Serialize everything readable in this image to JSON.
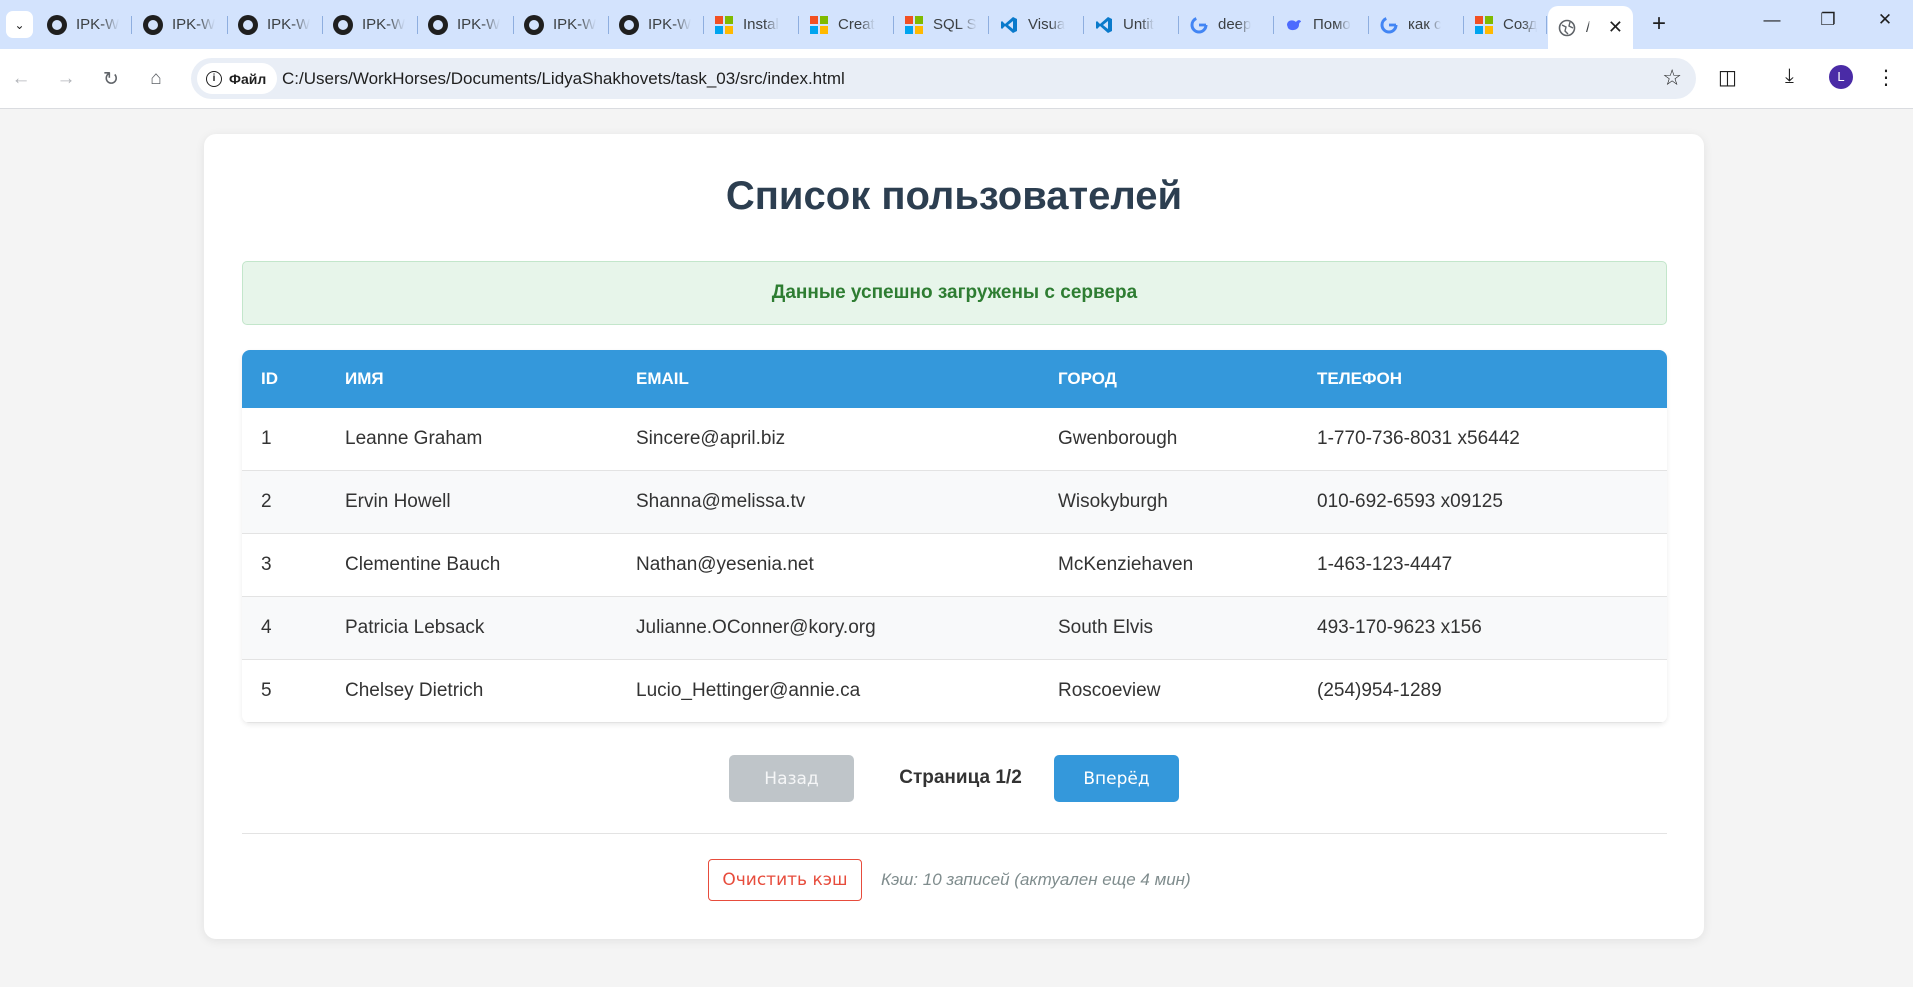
{
  "browser": {
    "tabs": [
      {
        "label": "IPK-W",
        "icon": "github-icon"
      },
      {
        "label": "IPK-W",
        "icon": "github-icon"
      },
      {
        "label": "IPK-W",
        "icon": "github-icon"
      },
      {
        "label": "IPK-W",
        "icon": "github-icon"
      },
      {
        "label": "IPK-W",
        "icon": "github-icon"
      },
      {
        "label": "IPK-W",
        "icon": "github-icon"
      },
      {
        "label": "IPK-W",
        "icon": "github-icon"
      },
      {
        "label": "Instal",
        "icon": "microsoft-icon"
      },
      {
        "label": "Creat",
        "icon": "microsoft-icon"
      },
      {
        "label": "SQL S",
        "icon": "microsoft-icon"
      },
      {
        "label": "Visua",
        "icon": "vscode-icon"
      },
      {
        "label": "Untit",
        "icon": "vscode-icon"
      },
      {
        "label": "deep",
        "icon": "google-icon"
      },
      {
        "label": "Помо",
        "icon": "deepseek-icon"
      },
      {
        "label": "как с",
        "icon": "google-icon"
      },
      {
        "label": "Созд",
        "icon": "microsoft-icon"
      },
      {
        "label": "/",
        "icon": "globe-icon",
        "active": true
      }
    ],
    "site_info_chip": "Файл",
    "url": "C:/Users/WorkHorses/Documents/LidyaShakhovets/task_03/src/index.html",
    "profile_initial": "L"
  },
  "page": {
    "title": "Список пользователей",
    "status_message": "Данные успешно загружены с сервера",
    "table": {
      "headers": [
        "ID",
        "Имя",
        "Email",
        "Город",
        "Телефон"
      ],
      "rows": [
        [
          "1",
          "Leanne Graham",
          "Sincere@april.biz",
          "Gwenborough",
          "1-770-736-8031 x56442"
        ],
        [
          "2",
          "Ervin Howell",
          "Shanna@melissa.tv",
          "Wisokyburgh",
          "010-692-6593 x09125"
        ],
        [
          "3",
          "Clementine Bauch",
          "Nathan@yesenia.net",
          "McKenziehaven",
          "1-463-123-4447"
        ],
        [
          "4",
          "Patricia Lebsack",
          "Julianne.OConner@kory.org",
          "South Elvis",
          "493-170-9623 x156"
        ],
        [
          "5",
          "Chelsey Dietrich",
          "Lucio_Hettinger@annie.ca",
          "Roscoeview",
          "(254)954-1289"
        ]
      ]
    },
    "pagination": {
      "prev_label": "Назад",
      "page_info": "Страница 1/2",
      "next_label": "Вперёд"
    },
    "cache": {
      "clear_label": "Очистить кэш",
      "info": "Кэш: 10 записей (актуален еще 4 мин)"
    }
  },
  "colors": {
    "accent": "#3498db",
    "success_bg": "#e7f5ea",
    "success_text": "#2e7d32",
    "danger": "#e74c3c",
    "title": "#2c3e50"
  }
}
